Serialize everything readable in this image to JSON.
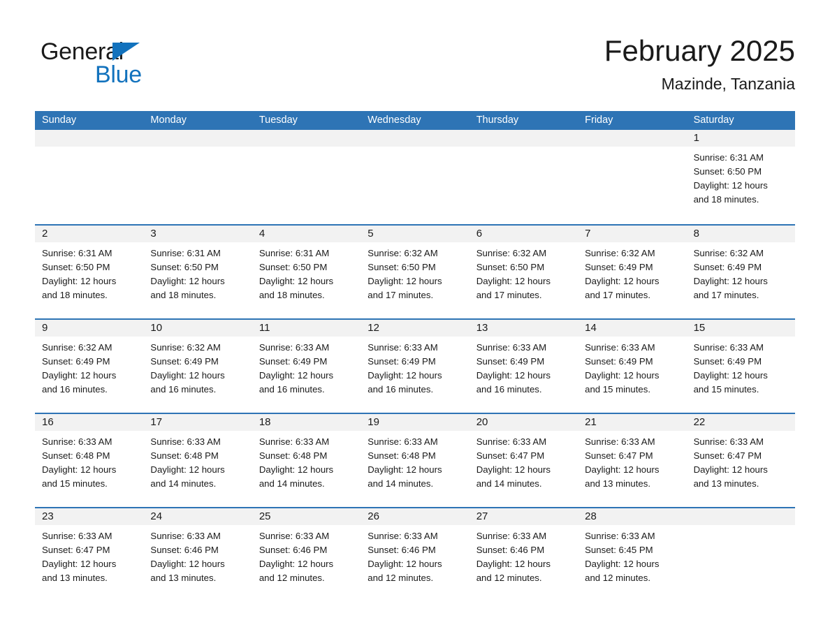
{
  "brand": {
    "name_part1": "General",
    "name_part2": "Blue",
    "triangle_color": "#1272bd",
    "text_color": "#1a1a1a"
  },
  "header": {
    "month_title": "February 2025",
    "location": "Mazinde, Tanzania"
  },
  "theme": {
    "header_blue": "#2e74b5",
    "day_band_gray": "#f2f2f2",
    "text": "#1a1a1a",
    "white": "#ffffff"
  },
  "weekdays": [
    "Sunday",
    "Monday",
    "Tuesday",
    "Wednesday",
    "Thursday",
    "Friday",
    "Saturday"
  ],
  "weeks": [
    [
      {
        "day": "",
        "sunrise": "",
        "sunset": "",
        "daylight1": "",
        "daylight2": ""
      },
      {
        "day": "",
        "sunrise": "",
        "sunset": "",
        "daylight1": "",
        "daylight2": ""
      },
      {
        "day": "",
        "sunrise": "",
        "sunset": "",
        "daylight1": "",
        "daylight2": ""
      },
      {
        "day": "",
        "sunrise": "",
        "sunset": "",
        "daylight1": "",
        "daylight2": ""
      },
      {
        "day": "",
        "sunrise": "",
        "sunset": "",
        "daylight1": "",
        "daylight2": ""
      },
      {
        "day": "",
        "sunrise": "",
        "sunset": "",
        "daylight1": "",
        "daylight2": ""
      },
      {
        "day": "1",
        "sunrise": "Sunrise: 6:31 AM",
        "sunset": "Sunset: 6:50 PM",
        "daylight1": "Daylight: 12 hours",
        "daylight2": "and 18 minutes."
      }
    ],
    [
      {
        "day": "2",
        "sunrise": "Sunrise: 6:31 AM",
        "sunset": "Sunset: 6:50 PM",
        "daylight1": "Daylight: 12 hours",
        "daylight2": "and 18 minutes."
      },
      {
        "day": "3",
        "sunrise": "Sunrise: 6:31 AM",
        "sunset": "Sunset: 6:50 PM",
        "daylight1": "Daylight: 12 hours",
        "daylight2": "and 18 minutes."
      },
      {
        "day": "4",
        "sunrise": "Sunrise: 6:31 AM",
        "sunset": "Sunset: 6:50 PM",
        "daylight1": "Daylight: 12 hours",
        "daylight2": "and 18 minutes."
      },
      {
        "day": "5",
        "sunrise": "Sunrise: 6:32 AM",
        "sunset": "Sunset: 6:50 PM",
        "daylight1": "Daylight: 12 hours",
        "daylight2": "and 17 minutes."
      },
      {
        "day": "6",
        "sunrise": "Sunrise: 6:32 AM",
        "sunset": "Sunset: 6:50 PM",
        "daylight1": "Daylight: 12 hours",
        "daylight2": "and 17 minutes."
      },
      {
        "day": "7",
        "sunrise": "Sunrise: 6:32 AM",
        "sunset": "Sunset: 6:49 PM",
        "daylight1": "Daylight: 12 hours",
        "daylight2": "and 17 minutes."
      },
      {
        "day": "8",
        "sunrise": "Sunrise: 6:32 AM",
        "sunset": "Sunset: 6:49 PM",
        "daylight1": "Daylight: 12 hours",
        "daylight2": "and 17 minutes."
      }
    ],
    [
      {
        "day": "9",
        "sunrise": "Sunrise: 6:32 AM",
        "sunset": "Sunset: 6:49 PM",
        "daylight1": "Daylight: 12 hours",
        "daylight2": "and 16 minutes."
      },
      {
        "day": "10",
        "sunrise": "Sunrise: 6:32 AM",
        "sunset": "Sunset: 6:49 PM",
        "daylight1": "Daylight: 12 hours",
        "daylight2": "and 16 minutes."
      },
      {
        "day": "11",
        "sunrise": "Sunrise: 6:33 AM",
        "sunset": "Sunset: 6:49 PM",
        "daylight1": "Daylight: 12 hours",
        "daylight2": "and 16 minutes."
      },
      {
        "day": "12",
        "sunrise": "Sunrise: 6:33 AM",
        "sunset": "Sunset: 6:49 PM",
        "daylight1": "Daylight: 12 hours",
        "daylight2": "and 16 minutes."
      },
      {
        "day": "13",
        "sunrise": "Sunrise: 6:33 AM",
        "sunset": "Sunset: 6:49 PM",
        "daylight1": "Daylight: 12 hours",
        "daylight2": "and 16 minutes."
      },
      {
        "day": "14",
        "sunrise": "Sunrise: 6:33 AM",
        "sunset": "Sunset: 6:49 PM",
        "daylight1": "Daylight: 12 hours",
        "daylight2": "and 15 minutes."
      },
      {
        "day": "15",
        "sunrise": "Sunrise: 6:33 AM",
        "sunset": "Sunset: 6:49 PM",
        "daylight1": "Daylight: 12 hours",
        "daylight2": "and 15 minutes."
      }
    ],
    [
      {
        "day": "16",
        "sunrise": "Sunrise: 6:33 AM",
        "sunset": "Sunset: 6:48 PM",
        "daylight1": "Daylight: 12 hours",
        "daylight2": "and 15 minutes."
      },
      {
        "day": "17",
        "sunrise": "Sunrise: 6:33 AM",
        "sunset": "Sunset: 6:48 PM",
        "daylight1": "Daylight: 12 hours",
        "daylight2": "and 14 minutes."
      },
      {
        "day": "18",
        "sunrise": "Sunrise: 6:33 AM",
        "sunset": "Sunset: 6:48 PM",
        "daylight1": "Daylight: 12 hours",
        "daylight2": "and 14 minutes."
      },
      {
        "day": "19",
        "sunrise": "Sunrise: 6:33 AM",
        "sunset": "Sunset: 6:48 PM",
        "daylight1": "Daylight: 12 hours",
        "daylight2": "and 14 minutes."
      },
      {
        "day": "20",
        "sunrise": "Sunrise: 6:33 AM",
        "sunset": "Sunset: 6:47 PM",
        "daylight1": "Daylight: 12 hours",
        "daylight2": "and 14 minutes."
      },
      {
        "day": "21",
        "sunrise": "Sunrise: 6:33 AM",
        "sunset": "Sunset: 6:47 PM",
        "daylight1": "Daylight: 12 hours",
        "daylight2": "and 13 minutes."
      },
      {
        "day": "22",
        "sunrise": "Sunrise: 6:33 AM",
        "sunset": "Sunset: 6:47 PM",
        "daylight1": "Daylight: 12 hours",
        "daylight2": "and 13 minutes."
      }
    ],
    [
      {
        "day": "23",
        "sunrise": "Sunrise: 6:33 AM",
        "sunset": "Sunset: 6:47 PM",
        "daylight1": "Daylight: 12 hours",
        "daylight2": "and 13 minutes."
      },
      {
        "day": "24",
        "sunrise": "Sunrise: 6:33 AM",
        "sunset": "Sunset: 6:46 PM",
        "daylight1": "Daylight: 12 hours",
        "daylight2": "and 13 minutes."
      },
      {
        "day": "25",
        "sunrise": "Sunrise: 6:33 AM",
        "sunset": "Sunset: 6:46 PM",
        "daylight1": "Daylight: 12 hours",
        "daylight2": "and 12 minutes."
      },
      {
        "day": "26",
        "sunrise": "Sunrise: 6:33 AM",
        "sunset": "Sunset: 6:46 PM",
        "daylight1": "Daylight: 12 hours",
        "daylight2": "and 12 minutes."
      },
      {
        "day": "27",
        "sunrise": "Sunrise: 6:33 AM",
        "sunset": "Sunset: 6:46 PM",
        "daylight1": "Daylight: 12 hours",
        "daylight2": "and 12 minutes."
      },
      {
        "day": "28",
        "sunrise": "Sunrise: 6:33 AM",
        "sunset": "Sunset: 6:45 PM",
        "daylight1": "Daylight: 12 hours",
        "daylight2": "and 12 minutes."
      },
      {
        "day": "",
        "sunrise": "",
        "sunset": "",
        "daylight1": "",
        "daylight2": ""
      }
    ]
  ]
}
